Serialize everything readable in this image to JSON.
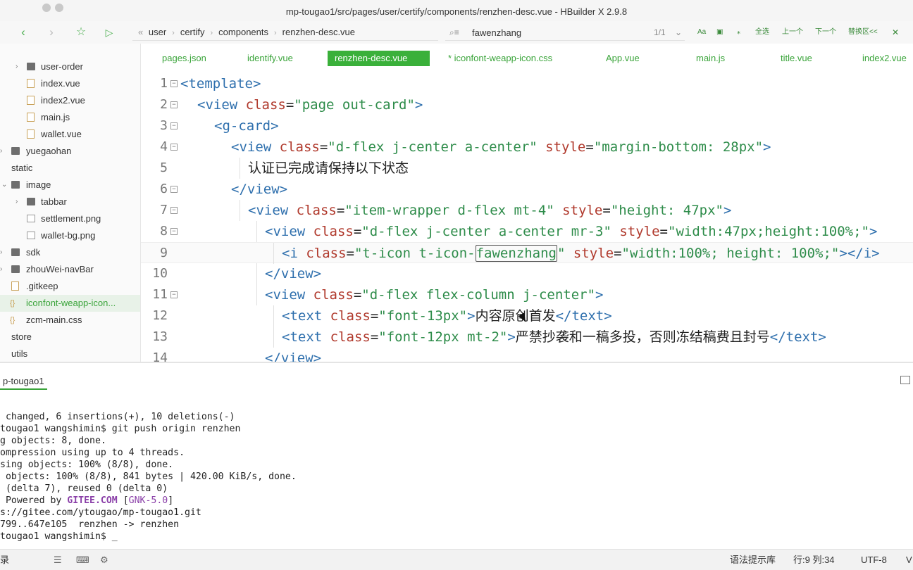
{
  "window": {
    "title": "mp-tougao1/src/pages/user/certify/components/renzhen-desc.vue - HBuilder X 2.9.8"
  },
  "toolbar": {
    "breadcrumb": [
      "user",
      "certify",
      "components",
      "renzhen-desc.vue"
    ],
    "search_value": "fawenzhang",
    "search_count": "1/1",
    "find_buttons": [
      "Aa",
      "全选",
      "上一个",
      "下一个",
      "替换区<<"
    ]
  },
  "sidebar": {
    "items": [
      {
        "label": "user-order",
        "kind": "folder",
        "arrow": "›"
      },
      {
        "label": "index.vue",
        "kind": "file"
      },
      {
        "label": "index2.vue",
        "kind": "file"
      },
      {
        "label": "main.js",
        "kind": "file"
      },
      {
        "label": "wallet.vue",
        "kind": "file"
      },
      {
        "label": "yuegaohan",
        "kind": "folder",
        "arrow": "›"
      },
      {
        "label": "static",
        "kind": "root"
      },
      {
        "label": "image",
        "kind": "folder",
        "arrow": "⌄"
      },
      {
        "label": "tabbar",
        "kind": "folder",
        "arrow": "›"
      },
      {
        "label": "settlement.png",
        "kind": "img"
      },
      {
        "label": "wallet-bg.png",
        "kind": "img"
      },
      {
        "label": "sdk",
        "kind": "folder",
        "arrow": "›"
      },
      {
        "label": "zhouWei-navBar",
        "kind": "folder",
        "arrow": "›"
      },
      {
        "label": ".gitkeep",
        "kind": "file"
      },
      {
        "label": "iconfont-weapp-icon...",
        "kind": "css"
      },
      {
        "label": "zcm-main.css",
        "kind": "css"
      },
      {
        "label": "store",
        "kind": "root"
      },
      {
        "label": "utils",
        "kind": "root"
      }
    ]
  },
  "tabs": [
    "pages.json",
    "identify.vue",
    "renzhen-desc.vue",
    "* iconfont-weapp-icon.css",
    "App.vue",
    "main.js",
    "title.vue",
    "index2.vue"
  ],
  "editor": {
    "line_numbers": [
      "1",
      "2",
      "3",
      "4",
      "5",
      "6",
      "7",
      "8",
      "9",
      "10",
      "11",
      "12",
      "13",
      "14"
    ],
    "t": {
      "template": "<template>",
      "view_open": "<view",
      "view_close": "</view>",
      "view_gt": ">",
      "class": " class",
      "eq": "=",
      "style": " style",
      "s_page": "\"page out-card\"",
      "gcard": "<g-card>",
      "s_dflex": "\"d-flex j-center a-center\"",
      "s_mb": "\"margin-bottom: 28px\"",
      "text5": "认证已完成请保持以下状态",
      "s_item": "\"item-wrapper d-flex mt-4\"",
      "s_h47": "\"height: 47px\"",
      "s_dflex_mr": "\"d-flex j-center a-center mr-3\"",
      "s_w47": "\"width:47px;height:100%;\"",
      "i_open": "<i",
      "s_icon_a": "\"t-icon t-icon-",
      "s_icon_hl": "fawenzhang",
      "s_icon_b": "\"",
      "s_full": "\"width:100%; height: 100%;\"",
      "i_close": "></i>",
      "s_col": "\"d-flex flex-column j-center\"",
      "text_open": "<text",
      "text_close": "</text>",
      "s_f13": "\"font-13px\"",
      "text12": "内容原创首发",
      "s_f12": "\"font-12px mt-2\"",
      "text13": "严禁抄袭和一稿多投，否则冻结稿费且封号",
      "partial14": "</view>"
    }
  },
  "terminal": {
    "tab_label": "p-tougao1",
    "lines": [
      " changed, 6 insertions(+), 10 deletions(-)",
      "tougao1 wangshimin$ git push origin renzhen",
      "g objects: 8, done.",
      "ompression using up to 4 threads.",
      "sing objects: 100% (8/8), done.",
      " objects: 100% (8/8), 841 bytes | 420.00 KiB/s, done.",
      " (delta 7), reused 0 (delta 0)"
    ],
    "powered_prefix": " Powered by ",
    "powered_brand": "GITEE.COM",
    "powered_mid": " [",
    "powered_gnk": "GNK-5.0",
    "powered_end": "]",
    "lines_after": [
      "s://gitee.com/ytougao/mp-tougao1.git",
      "799..647e105  renzhen -> renzhen",
      "tougao1 wangshimin$ _"
    ]
  },
  "statusbar": {
    "left_label": "录",
    "hint_lib": "语法提示库",
    "position": "行:9  列:34",
    "encoding": "UTF-8",
    "tail": "V"
  }
}
